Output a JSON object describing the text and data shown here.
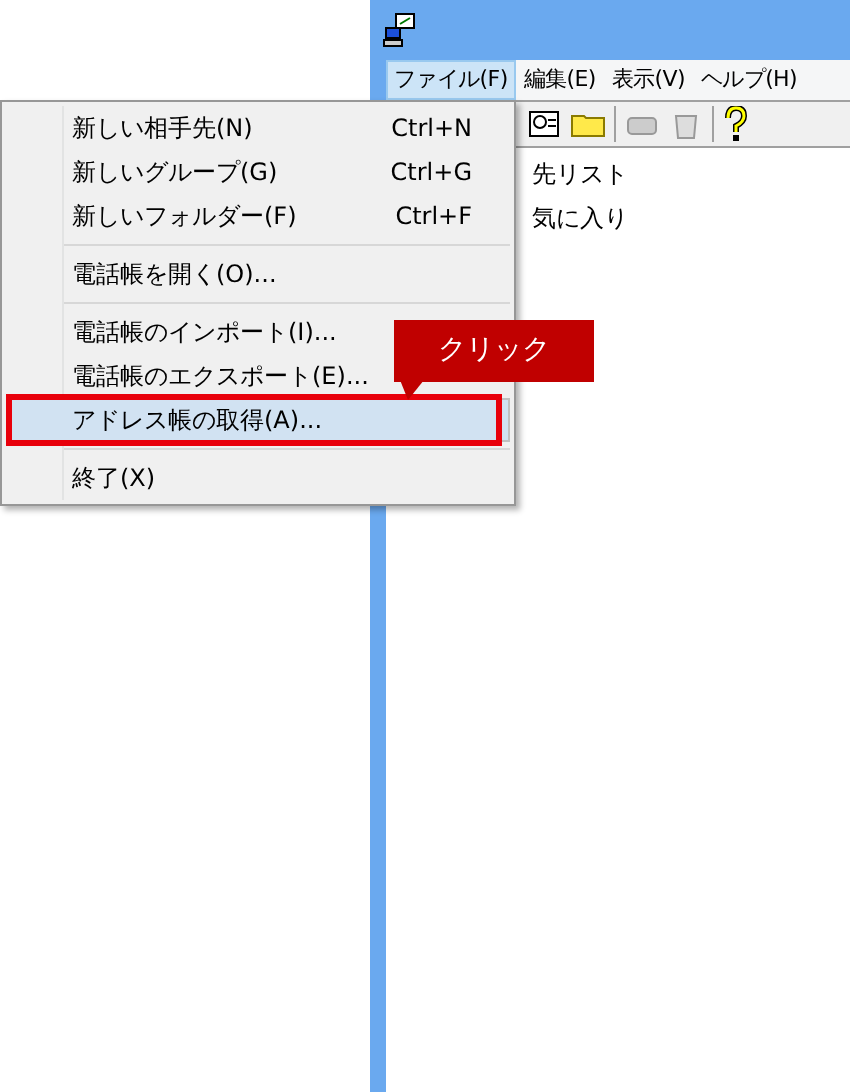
{
  "window": {
    "menu_bar": [
      {
        "label": "ファイル(F)",
        "selected": true
      },
      {
        "label": "編集(E)",
        "selected": false
      },
      {
        "label": "表示(V)",
        "selected": false
      },
      {
        "label": "ヘルプ(H)",
        "selected": false
      }
    ],
    "tree": [
      {
        "label": "先リスト"
      },
      {
        "label": "気に入り"
      }
    ]
  },
  "menu": {
    "items": [
      {
        "kind": "item",
        "label": "新しい相手先(N)",
        "shortcut": "Ctrl+N",
        "selected": false
      },
      {
        "kind": "item",
        "label": "新しいグループ(G)",
        "shortcut": "Ctrl+G",
        "selected": false
      },
      {
        "kind": "item",
        "label": "新しいフォルダー(F)",
        "shortcut": "Ctrl+F",
        "selected": false
      },
      {
        "kind": "separator"
      },
      {
        "kind": "item",
        "label": "電話帳を開く(O)...",
        "selected": false
      },
      {
        "kind": "separator"
      },
      {
        "kind": "item",
        "label": "電話帳のインポート(I)...",
        "selected": false
      },
      {
        "kind": "item",
        "label": "電話帳のエクスポート(E)...",
        "selected": false
      },
      {
        "kind": "item",
        "label": "アドレス帳の取得(A)...",
        "selected": true
      },
      {
        "kind": "separator"
      },
      {
        "kind": "item",
        "label": "終了(X)",
        "selected": false
      }
    ]
  },
  "callout": {
    "text": "クリック"
  }
}
